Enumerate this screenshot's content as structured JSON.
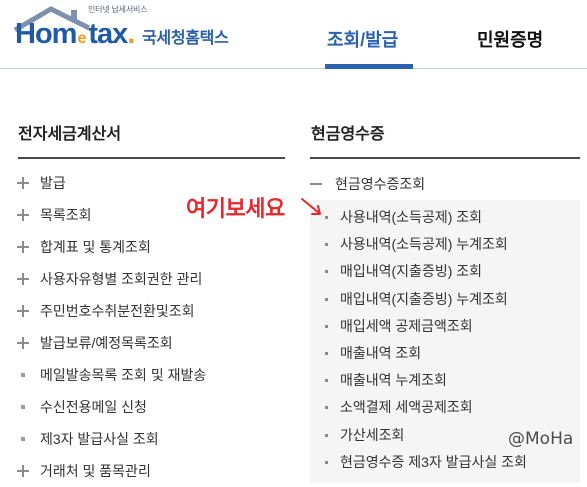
{
  "header": {
    "logo": {
      "tagline": "인터넷 납세서비스",
      "wordmark": [
        "Hom",
        "e",
        "tax",
        "."
      ],
      "name": "국세청홈택스",
      "icon": "house-roof-icon"
    },
    "nav": [
      {
        "label": "조회/발급",
        "active": true
      },
      {
        "label": "민원증명",
        "active": false
      }
    ]
  },
  "left_section": {
    "title": "전자세금계산서",
    "items": [
      {
        "label": "발급",
        "icon": "plus-icon"
      },
      {
        "label": "목록조회",
        "icon": "plus-icon"
      },
      {
        "label": "합계표 및 통계조회",
        "icon": "plus-icon"
      },
      {
        "label": "사용자유형별 조회권한 관리",
        "icon": "plus-icon"
      },
      {
        "label": "주민번호수취분전환및조회",
        "icon": "plus-icon"
      },
      {
        "label": "발급보류/예정목록조회",
        "icon": "plus-icon"
      },
      {
        "label": "메일발송목록 조회 및 재발송",
        "icon": "square-bullet-icon"
      },
      {
        "label": "수신전용메일 신청",
        "icon": "square-bullet-icon"
      },
      {
        "label": "제3자 발급사실 조회",
        "icon": "square-bullet-icon"
      },
      {
        "label": "거래처 및 품목관리",
        "icon": "plus-icon"
      }
    ]
  },
  "right_section": {
    "title": "현금영수증",
    "expanded_item": {
      "label": "현금영수증조회",
      "icon": "minus-icon",
      "expanded": true
    },
    "sub_items": [
      "사용내역(소득공제) 조회",
      "사용내역(소득공제) 누계조회",
      "매입내역(지출증빙) 조회",
      "매입내역(지출증빙) 누계조회",
      "매입세액 공제금액조회",
      "매출내역 조회",
      "매출내역 누계조회",
      "소액결제 세액공제조회",
      "가산세조회",
      "현금영수증 제3자 발급사실 조회"
    ]
  },
  "annotation": {
    "text": "여기보세요",
    "icon": "arrow-down-right-icon"
  },
  "watermark": {
    "text": "@MoHa"
  },
  "colors": {
    "brand_blue": "#1f5aa6",
    "nav_active": "#2c62b2",
    "logo_accent": "#f39a1f",
    "annotation_red": "#e8262b",
    "submenu_bg": "#f5f5f5",
    "text": "#333333"
  }
}
